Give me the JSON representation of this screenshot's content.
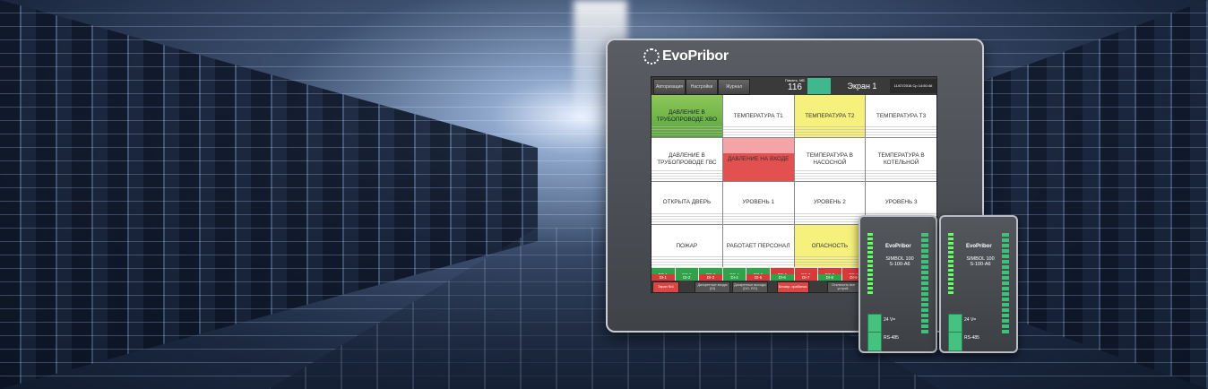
{
  "panel": {
    "brand": "EvoPribor",
    "topbar": {
      "auth": "Авторизация",
      "settings": "Настройки",
      "journal": "Журнал",
      "memory_label": "Память, МБ",
      "memory_value": "116",
      "screen_title": "Экран 1",
      "datetime": "11/07/2016 Ср 14:50:46"
    },
    "tiles": [
      {
        "label": "ДАВЛЕНИЕ В ТРУБОПРОВОДЕ ХВО",
        "state": "green"
      },
      {
        "label": "ТЕМПЕРАТУРА Т1",
        "state": "white"
      },
      {
        "label": "ТЕМПЕРАТУРА Т2",
        "state": "yellow"
      },
      {
        "label": "ТЕМПЕРАТУРА Т3",
        "state": "white"
      },
      {
        "label": "ДАВЛЕНИЕ В ТРУБОПРОВОДЕ ГВС",
        "state": "white"
      },
      {
        "label": "ДАВЛЕНИЕ НА ВХОДЕ",
        "state": "red"
      },
      {
        "label": "ТЕМПЕРАТУРА В НАСОСНОЙ",
        "state": "white"
      },
      {
        "label": "ТЕМПЕРАТУРА В КОТЕЛЬНОЙ",
        "state": "white"
      },
      {
        "label": "ОТКРЫТА ДВЕРЬ",
        "state": "white"
      },
      {
        "label": "УРОВЕНЬ 1",
        "state": "white"
      },
      {
        "label": "УРОВЕНЬ 2",
        "state": "white"
      },
      {
        "label": "УРОВЕНЬ 3",
        "state": "white"
      },
      {
        "label": "ПОЖАР",
        "state": "white"
      },
      {
        "label": "РАБОТАЕТ ПЕРСОНАЛ",
        "state": "white"
      },
      {
        "label": "ОПАСНОСТЬ",
        "state": "yellow"
      },
      {
        "label": "",
        "state": "white"
      }
    ],
    "do_row": [
      "DO-1",
      "DO-2",
      "DO-3",
      "DO-4",
      "DO-5",
      "DO-6",
      "DO-7",
      "DO-8",
      "DO-9",
      "DO-10",
      "DO-11",
      "DO-12"
    ],
    "di_row": [
      "DI-1",
      "DI-2",
      "DI-3",
      "DI-4",
      "DI-5",
      "DI-6",
      "DI-7",
      "DI-8",
      "DI-9",
      "DI-10",
      "DI-11",
      "DI-12"
    ],
    "bottom": {
      "screen_no": "Экран №1",
      "di": "Дискретные входы (DI)",
      "do": "Дискретные выходы (DO, RO)",
      "block": "Блокир. срабатыв.",
      "off": "Отключить все устрой."
    }
  },
  "modules": [
    {
      "brand": "EvoPribor",
      "name": "SIMBOL 100",
      "sub": "S-100-A6",
      "v": "24 V=",
      "rs": "RS-485"
    },
    {
      "brand": "EvoPribor",
      "name": "SIMBOL 100",
      "sub": "S-100-A6",
      "v": "24 V=",
      "rs": "RS-485"
    }
  ]
}
